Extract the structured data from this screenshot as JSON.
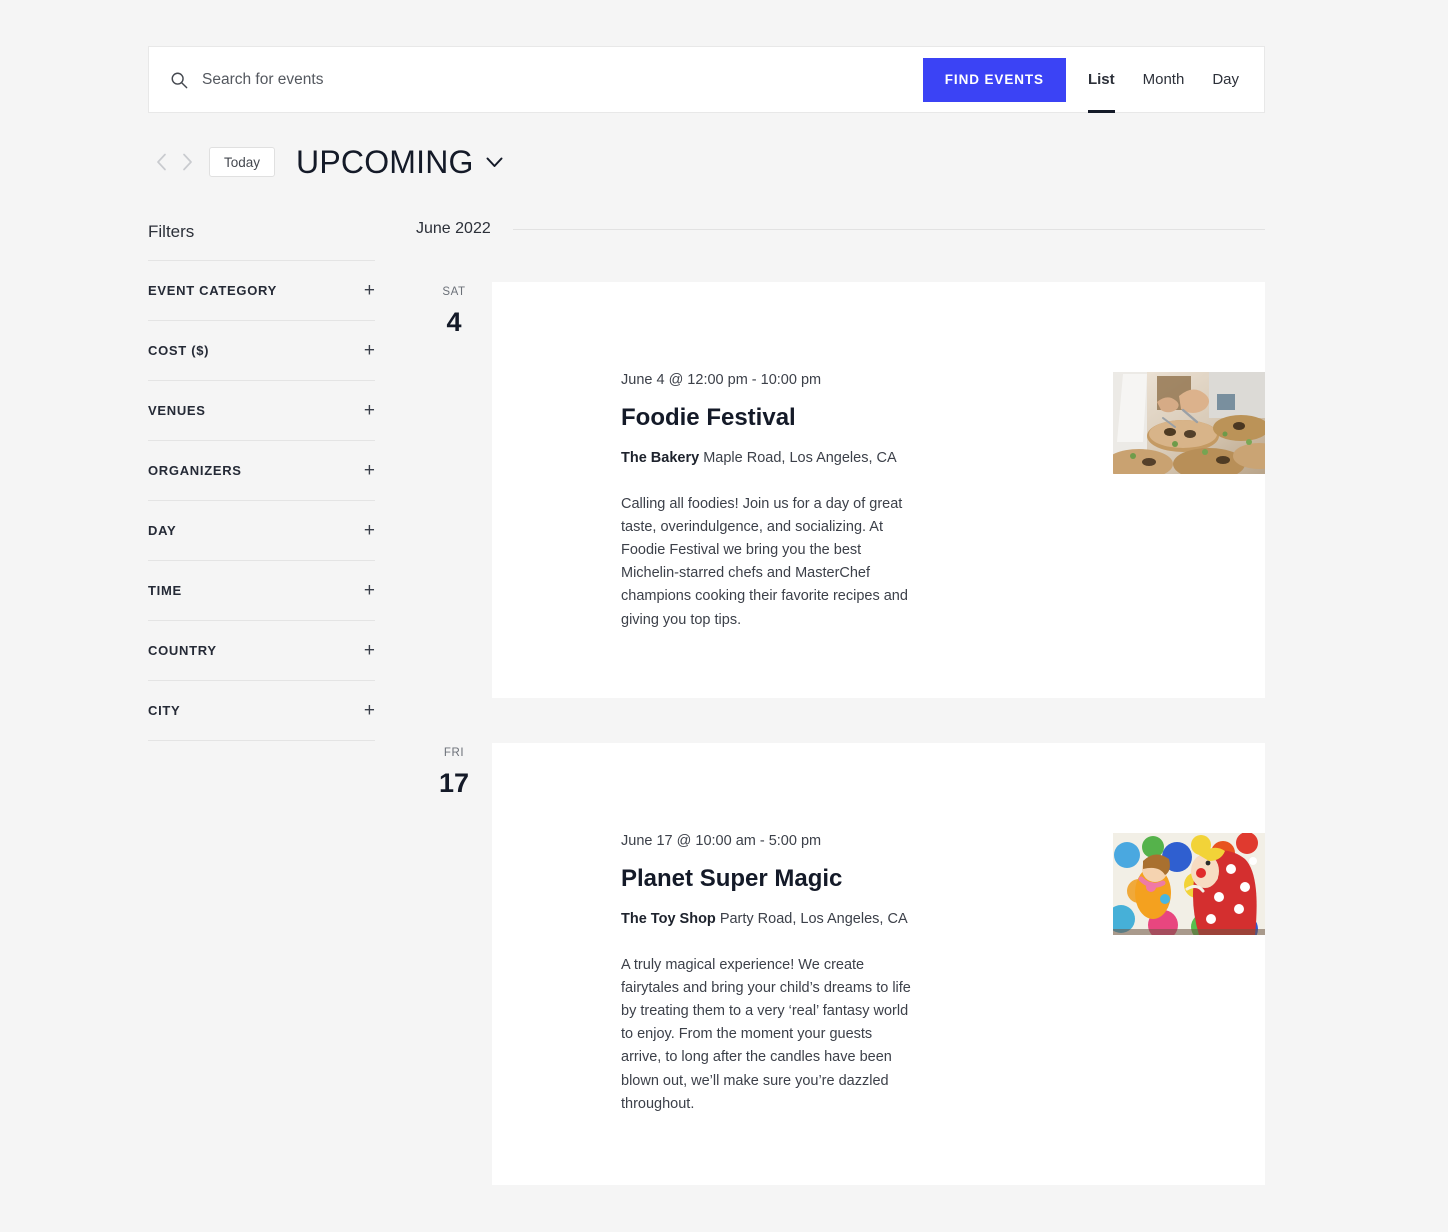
{
  "header": {
    "search": {
      "placeholder": "Search for events",
      "value": "",
      "icon": "search-icon"
    },
    "find_events_label": "FIND EVENTS",
    "accent_color": "#3b43f5",
    "views": [
      {
        "label": "List",
        "active": true
      },
      {
        "label": "Month",
        "active": false
      },
      {
        "label": "Day",
        "active": false
      }
    ]
  },
  "nav": {
    "prev_icon": "chevron-left-icon",
    "next_icon": "chevron-right-icon",
    "today_label": "Today",
    "title": "UPCOMING",
    "title_chevron": "chevron-down-icon"
  },
  "sidebar": {
    "title": "Filters",
    "expand_glyph": "+",
    "items": [
      {
        "label": "EVENT CATEGORY"
      },
      {
        "label": "COST ($)"
      },
      {
        "label": "VENUES"
      },
      {
        "label": "ORGANIZERS"
      },
      {
        "label": "DAY"
      },
      {
        "label": "TIME"
      },
      {
        "label": "COUNTRY"
      },
      {
        "label": "CITY"
      }
    ]
  },
  "main": {
    "month_label": "June 2022",
    "events": [
      {
        "day_of_week": "SAT",
        "day_number": "4",
        "time": "June 4 @ 12:00 pm - 10:00 pm",
        "title": "Foodie Festival",
        "venue_name": "The Bakery",
        "venue_address": "Maple Road, Los Angeles, CA",
        "description": "Calling all foodies! Join us for a day of great taste, overindulgence, and socializing. At Foodie Festival we bring you the best Michelin-starred chefs and MasterChef champions cooking their favorite recipes and giving you top tips.",
        "image_alt": "chef-plating-food-photo"
      },
      {
        "day_of_week": "FRI",
        "day_number": "17",
        "time": "June 17 @ 10:00 am - 5:00 pm",
        "title": "Planet Super Magic",
        "venue_name": "The Toy Shop",
        "venue_address": "Party Road, Los Angeles, CA",
        "description": "A truly magical experience! We create fairytales and bring your child’s dreams to life by treating them to a very ‘real’ fantasy world to enjoy. From the moment your guests arrive, to long after the candles have been blown out, we’ll make sure you’re dazzled throughout.",
        "image_alt": "clown-with-child-and-balloons-photo"
      }
    ]
  }
}
